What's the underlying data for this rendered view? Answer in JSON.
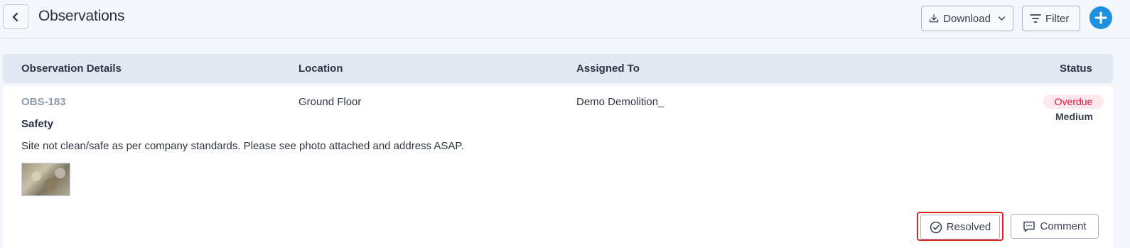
{
  "header": {
    "title": "Observations",
    "download_label": "Download",
    "filter_label": "Filter",
    "accent": "#1e90e0"
  },
  "table": {
    "columns": [
      "Observation Details",
      "Location",
      "Assigned To",
      "Status"
    ]
  },
  "observation": {
    "id": "OBS-183",
    "location": "Ground Floor",
    "assigned_to": "Demo Demolition_",
    "category": "Safety",
    "description": "Site not clean/safe as per company standards. Please see photo attached and address ASAP.",
    "status": "Overdue",
    "priority": "Medium",
    "status_color": "#e0143c"
  },
  "actions": {
    "resolved_label": "Resolved",
    "comment_label": "Comment"
  }
}
